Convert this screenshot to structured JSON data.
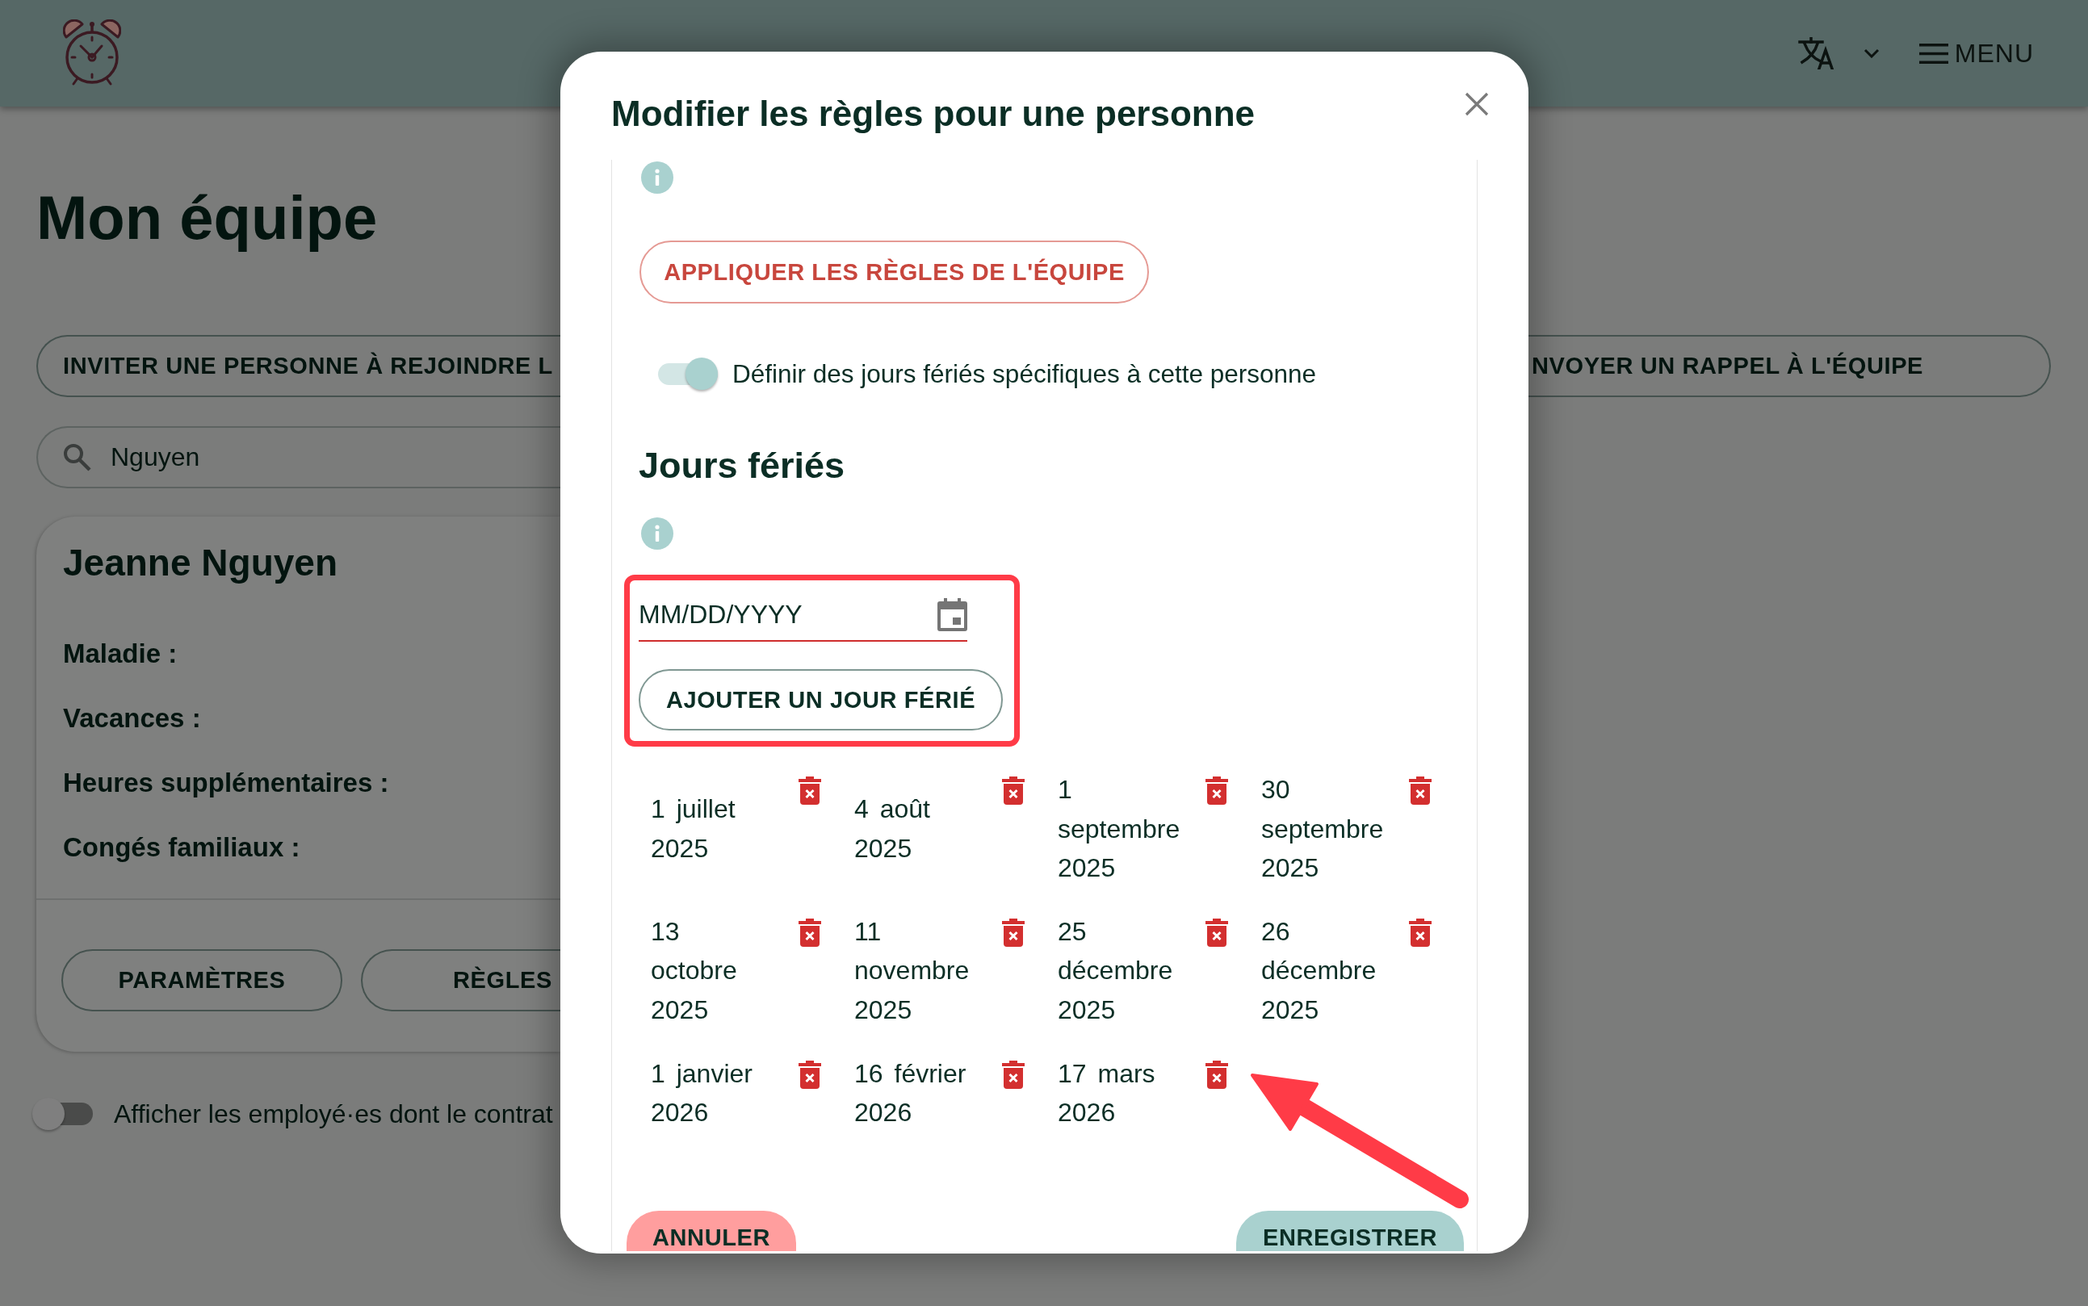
{
  "header": {
    "menu_label": "MENU"
  },
  "page": {
    "title": "Mon équipe",
    "invite_button": "INVITER UNE PERSONNE À REJOINDRE L",
    "reminder_button": "NVOYER UN RAPPEL À L'ÉQUIPE",
    "search": {
      "value": "Nguyen"
    },
    "member_card": {
      "name": "Jeanne Nguyen",
      "fields": [
        "Maladie :",
        "Vacances :",
        "Heures supplémentaires :",
        "Congés familiaux :"
      ],
      "settings_button": "PARAMÈTRES",
      "rules_button": "RÈGLES"
    },
    "show_ended_contracts": {
      "label": "Afficher les employé·es dont le contrat",
      "on": false
    }
  },
  "dialog": {
    "title": "Modifier les règles pour une personne",
    "apply_team_rules_button": "APPLIQUER LES RÈGLES DE L'ÉQUIPE",
    "custom_holidays_toggle": {
      "label": "Définir des jours fériés spécifiques à cette personne",
      "on": true
    },
    "holidays": {
      "heading": "Jours fériés",
      "highlighted": true,
      "date_field": {
        "placeholder": "MM/DD/YYYY"
      },
      "add_button": "AJOUTER UN JOUR FÉRIÉ",
      "dates": [
        "1 juillet 2025",
        "4 août 2025",
        "1 septembre 2025",
        "30 septembre 2025",
        "13 octobre 2025",
        "11 novembre 2025",
        "25 décembre 2025",
        "26 décembre 2025",
        "1 janvier 2026",
        "16 février 2026",
        "17 mars 2026"
      ]
    },
    "footer_buttons": [
      {
        "label": "ANNULER",
        "kind": "cancel"
      },
      {
        "label": "ENREGISTRER",
        "kind": "save"
      }
    ]
  },
  "annotations": [
    {
      "kind": "arrow"
    }
  ]
}
